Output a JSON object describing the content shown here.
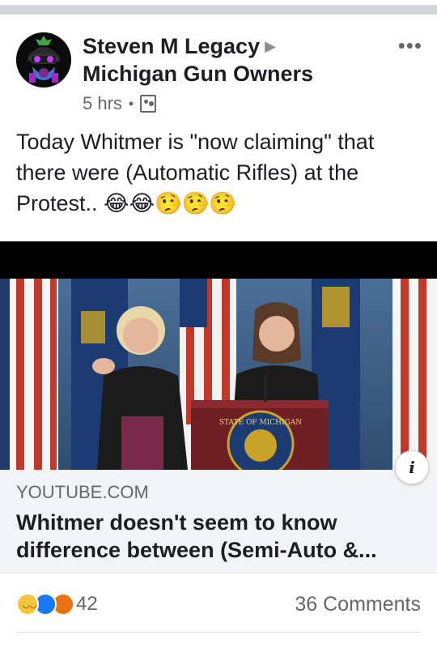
{
  "post": {
    "author": "Steven M Legacy",
    "group": "Michigan Gun Owners",
    "time": "5 hrs",
    "privacy_icon": "group-icon",
    "more_icon": "more-horizontal-icon",
    "text": "Today Whitmer is \"now claiming\" that there were (Automatic Rifles) at the Protest.. 😂😂🤥🤥🤥"
  },
  "link": {
    "domain": "YOUTUBE.COM",
    "title": "Whitmer doesn't seem to know difference between (Semi-Auto &...",
    "seal_text": "STATE OF MICHIGAN",
    "info_icon": "info-icon"
  },
  "reactions": {
    "icons": [
      "haha-icon",
      "like-icon",
      "angry-icon"
    ],
    "count": "42",
    "comments": "36 Comments"
  },
  "colors": {
    "separator": "#d2d5da",
    "secondary_text": "#65676b",
    "like_blue": "#1877f2",
    "haha_yellow": "#f7c33c",
    "angry_orange": "#e9710f"
  }
}
